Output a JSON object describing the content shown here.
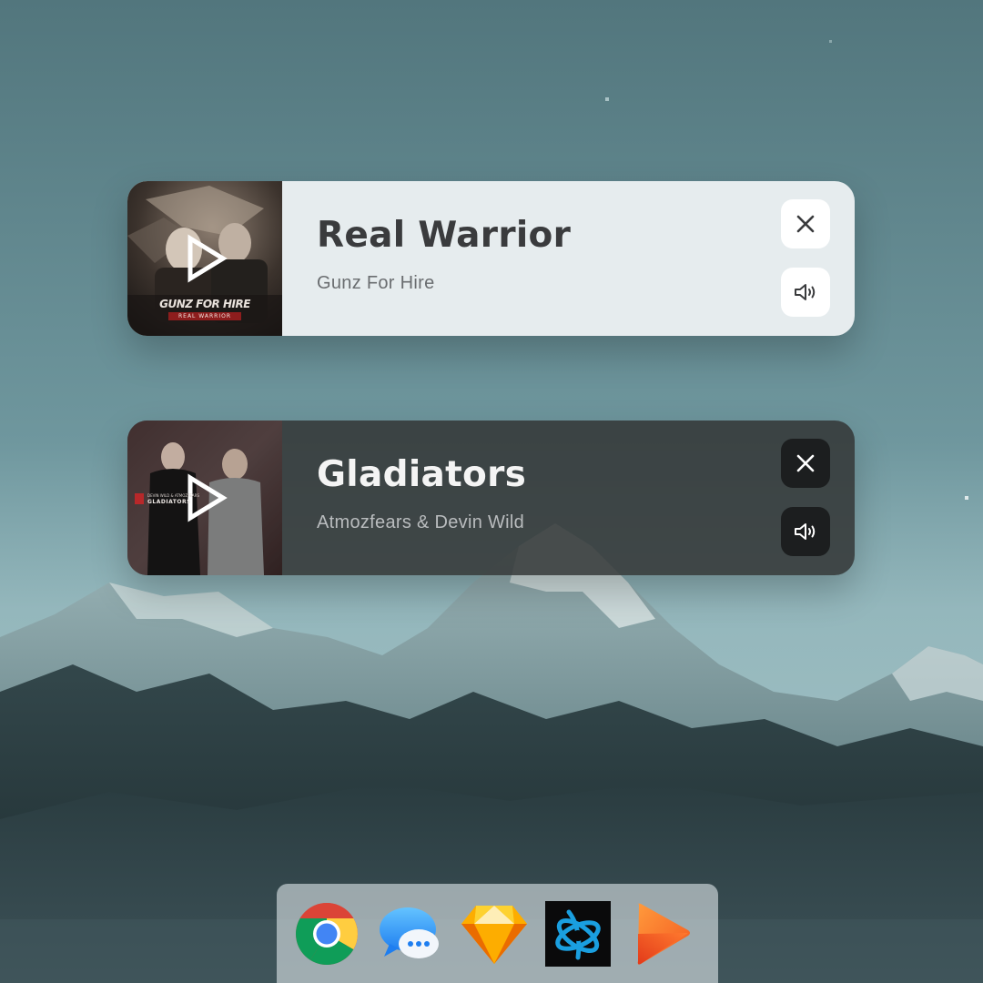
{
  "players": [
    {
      "title": "Real Warrior",
      "artist": "Gunz For Hire",
      "cover_text": "GUNZ FOR HIRE",
      "cover_subtext": "REAL WARRIOR",
      "theme": "light",
      "icons": {
        "play": "play-icon",
        "close": "close-icon",
        "volume": "volume-icon"
      }
    },
    {
      "title": "Gladiators",
      "artist": "Atmozfears & Devin Wild",
      "cover_text": "GLADIATORS",
      "cover_subtext": "DEVIN WILD & ATMOZFEARS",
      "theme": "dark",
      "icons": {
        "play": "play-icon",
        "close": "close-icon",
        "volume": "volume-icon"
      }
    }
  ],
  "dock": {
    "apps": [
      {
        "name": "Google Chrome",
        "icon": "chrome-icon"
      },
      {
        "name": "Messages",
        "icon": "messages-icon"
      },
      {
        "name": "Sketch",
        "icon": "sketch-icon"
      },
      {
        "name": "Battle.net",
        "icon": "battlenet-icon"
      },
      {
        "name": "Infuse",
        "icon": "infuse-icon"
      }
    ]
  },
  "colors": {
    "sky_top": "#53787f",
    "sky_bottom": "#8fb3b8",
    "card_light": "#e6ecee",
    "card_dark": "#343838",
    "sketch_orange": "#f7a823",
    "battlenet_blue": "#1a9fe0",
    "infuse_orange": "#f4581f"
  }
}
